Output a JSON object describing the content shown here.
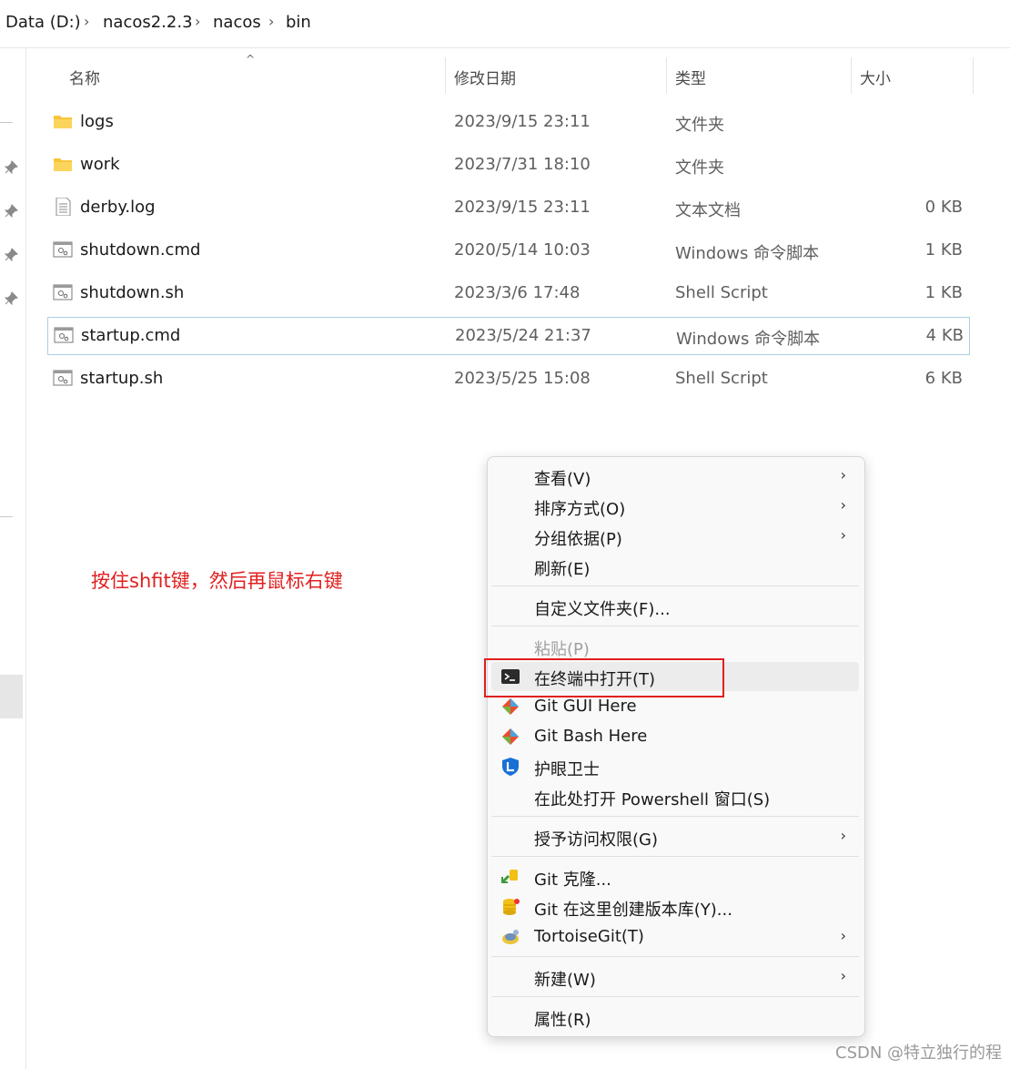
{
  "breadcrumb": [
    "Data (D:)",
    "nacos2.2.3",
    "nacos",
    "bin"
  ],
  "columns": {
    "name": "名称",
    "modified": "修改日期",
    "type": "类型",
    "size": "大小"
  },
  "files": [
    {
      "name": "logs",
      "modified": "2023/9/15 23:11",
      "type": "文件夹",
      "size": "",
      "icon": "folder-icon"
    },
    {
      "name": "work",
      "modified": "2023/7/31 18:10",
      "type": "文件夹",
      "size": "",
      "icon": "folder-icon"
    },
    {
      "name": "derby.log",
      "modified": "2023/9/15 23:11",
      "type": "文本文档",
      "size": "0 KB",
      "icon": "text-file-icon"
    },
    {
      "name": "shutdown.cmd",
      "modified": "2020/5/14 10:03",
      "type": "Windows 命令脚本",
      "size": "1 KB",
      "icon": "script-file-icon"
    },
    {
      "name": "shutdown.sh",
      "modified": "2023/3/6 17:48",
      "type": "Shell Script",
      "size": "1 KB",
      "icon": "script-file-icon"
    },
    {
      "name": "startup.cmd",
      "modified": "2023/5/24 21:37",
      "type": "Windows 命令脚本",
      "size": "4 KB",
      "icon": "script-file-icon",
      "selected": true
    },
    {
      "name": "startup.sh",
      "modified": "2023/5/25 15:08",
      "type": "Shell Script",
      "size": "6 KB",
      "icon": "script-file-icon"
    }
  ],
  "annotation": "按住shfit键，然后再鼠标右键",
  "context_menu": {
    "view": "查看(V)",
    "sort": "排序方式(O)",
    "group": "分组依据(P)",
    "refresh": "刷新(E)",
    "customize": "自定义文件夹(F)...",
    "paste": "粘贴(P)",
    "open_terminal": "在终端中打开(T)",
    "git_gui": "Git GUI Here",
    "git_bash": "Git Bash Here",
    "eye_guard": "护眼卫士",
    "powershell": "在此处打开 Powershell 窗口(S)",
    "grant_access": "授予访问权限(G)",
    "git_clone": "Git 克隆...",
    "git_create_repo": "Git 在这里创建版本库(Y)...",
    "tortoisegit": "TortoiseGit(T)",
    "new": "新建(W)",
    "properties": "属性(R)"
  },
  "colors": {
    "annotation": "#e02020",
    "selection_border": "#a9cfe8",
    "menu_bg": "#f9f9f9"
  },
  "watermark": "CSDN @特立独行的程"
}
